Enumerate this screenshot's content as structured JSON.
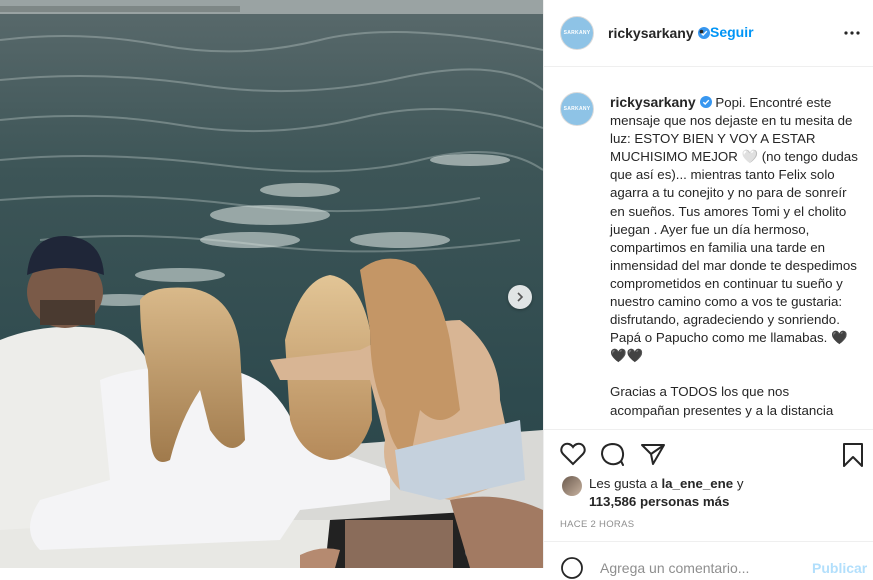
{
  "post": {
    "username": "rickysarkany",
    "avatar_text": "SARKANY",
    "follow_label": "Seguir",
    "separator": "•",
    "caption": "Popi. Encontré este mensaje que nos dejaste en tu mesita de luz: ESTOY BIEN Y VOY A ESTAR MUCHISIMO MEJOR 🤍 (no tengo dudas que así es)... mientras tanto Felix solo agarra a tu conejito y no para de sonreír en sueños. Tus amores Tomi y el cholito juegan . Ayer fue un día hermoso, compartimos en familia una tarde en inmensidad del mar donde te despedimos comprometidos en continuar tu sueño y nuestro camino como a vos te gustaria: disfrutando, agradeciendo y sonriendo. Papá o Papucho como me llamabas. 🖤🖤🖤",
    "caption_2": "Gracias a TODOS los que nos acompañan presentes y a la distancia"
  },
  "likes": {
    "prefix": "Les gusta a ",
    "liker": "la_ene_ene",
    "middle": " y",
    "count": "113,586 personas más"
  },
  "timestamp": "HACE 2 HORAS",
  "comment_bar": {
    "placeholder": "Agrega un comentario...",
    "post_label": "Publicar"
  },
  "icons": {
    "like": "heart-icon",
    "comment": "comment-icon",
    "share": "share-icon",
    "save": "bookmark-icon",
    "more": "more-options-icon",
    "next": "chevron-right-icon",
    "verified": "verified-badge-icon"
  },
  "colors": {
    "link_blue": "#0095f6",
    "verified_blue": "#3897f0",
    "text": "#262626",
    "muted": "#8e8e8e"
  }
}
